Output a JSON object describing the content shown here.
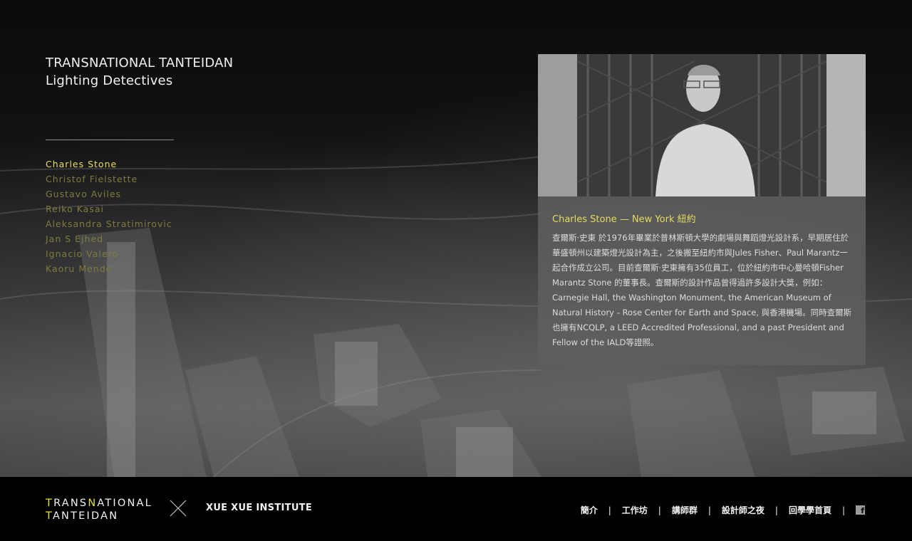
{
  "header": {
    "title_line1": "TRANSNATIONAL TANTEIDAN",
    "title_line2": "Lighting Detectives"
  },
  "detectives": [
    {
      "name": "Charles Stone",
      "active": true
    },
    {
      "name": "Christof Fielstette",
      "active": false
    },
    {
      "name": "Gustavo Aviles",
      "active": false
    },
    {
      "name": "Reiko Kasai",
      "active": false
    },
    {
      "name": "Aleksandra Stratimirovic",
      "active": false
    },
    {
      "name": "Jan S Ejhed",
      "active": false
    },
    {
      "name": "Ignacio Valero",
      "active": false
    },
    {
      "name": "Kaoru Mende",
      "active": false
    }
  ],
  "profile": {
    "heading": "Charles Stone — New York 紐約",
    "bio": "查爾斯·史東 於1976年畢業於普林斯頓大學的劇場與舞蹈燈光設計系，早期居住於華盛頓州以建築燈光設計為主，之後搬至紐約市與Jules Fisher、Paul Marantz一起合作成立公司。目前查爾斯·史東擁有35位員工，位於紐約市中心曼哈頓Fisher Marantz Stone 的董事長。查爾斯的設計作品曾得過許多設計大獎，例如：Carnegie Hall, the Washington Monument, the American Museum of Natural History - Rose Center for Earth and Space, 與香港機場。同時查爾斯也擁有NCQLP, a LEED Accredited Professional, and a past President and Fellow of the IALD等證照。"
  },
  "footer": {
    "logo": {
      "line1_a": "T",
      "line1_b": "RANS",
      "line1_c": "N",
      "line1_d": "ATIONAL",
      "line2_a": "T",
      "line2_b": "ANTEIDAN"
    },
    "partner": "XUE XUE INSTITUTE",
    "nav": [
      "簡介",
      "工作坊",
      "講師群",
      "設計師之夜",
      "回學學首頁"
    ],
    "separator": "|",
    "facebook_glyph": "f"
  },
  "colors": {
    "accent": "#e6df63",
    "muted_name": "#7e7b3c",
    "card_bg": "#5f5f5f",
    "footer_bg": "#000000"
  },
  "icons": [
    "close-x-divider-icon",
    "facebook-icon"
  ]
}
